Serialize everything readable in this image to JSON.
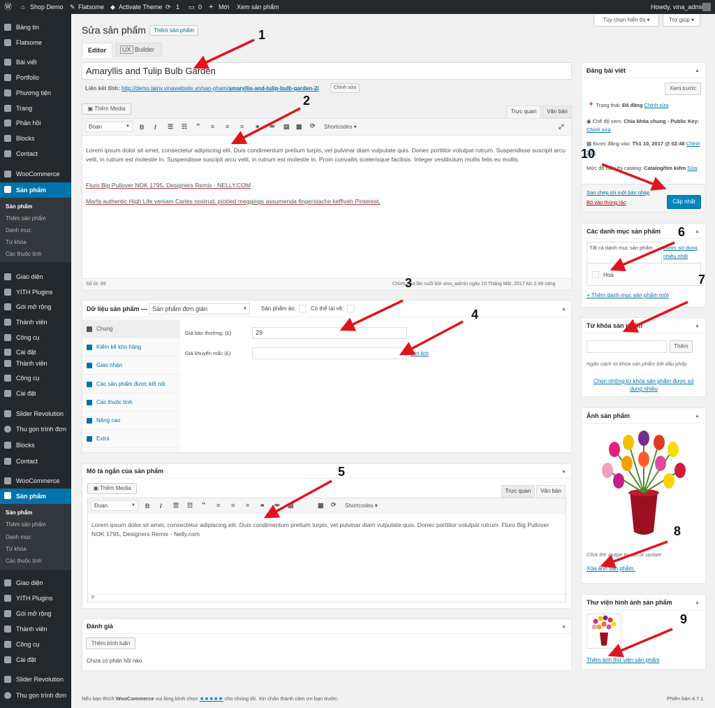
{
  "admin_bar": {
    "site": "Shop Demo",
    "theme": "Flatsome",
    "activate": "Activate Theme",
    "updates": "1",
    "comments": "0",
    "new": "Mới",
    "view": "Xem sản phẩm",
    "howdy": "Howdy, vina_admin"
  },
  "sidebar": {
    "top": [
      "Bảng tin",
      "Flatsome"
    ],
    "group1": [
      "Bài viết",
      "Portfolio",
      "Phương tiện",
      "Trang",
      "Phản hồi",
      "Blocks",
      "Contact"
    ],
    "woo": "WooCommerce",
    "products": "Sản phẩm",
    "sub": [
      "Sản phẩm",
      "Thêm sản phẩm",
      "Danh mục",
      "Từ khóa",
      "Các thuộc tính"
    ],
    "group2": [
      "Giao diện",
      "YITH Plugins",
      "Gói mở rộng",
      "Thành viên",
      "Công cụ",
      "Cài đặt"
    ],
    "mid_extra": [
      "Thành viên",
      "Công cụ",
      "Cài đặt"
    ],
    "slider": "Slider Revolution",
    "collapse": "Thu gọn trình đơn",
    "blocks": "Blocks",
    "contact": "Contact"
  },
  "screen_options": "Tùy chọn hiển thị ▾",
  "help": "Trợ giúp ▾",
  "page_title": "Sửa sản phẩm",
  "add_product": "Thêm sản phẩm",
  "editor_tabs": [
    "Editor",
    "UX",
    "Builder"
  ],
  "post_title": "Amaryllis and Tulip Bulb Garden",
  "permalink": {
    "label": "Liên kết tĩnh:",
    "url_pre": "http://demo.tainv.vinawebsite.vn/san-pham/",
    "slug": "amaryllis-and-tulip-bulb-garden-2/",
    "edit": "Chỉnh sửa"
  },
  "editor": {
    "add_media": "Thêm Media",
    "visual": "Trực quan",
    "text": "Văn bản",
    "format": "Đoạn",
    "shortcodes": "Shortcodes",
    "p1": "Lorem ipsum dolor sit amet, consectetur adipiscing elit. Duis condimentum pretium turpis, vel pulvinar diam vulputate quis. Donec porttitor volutpat rutrum. Suspendisse suscipit arcu velit, in rutrum est molestie in. Suspendisse suscipit arcu velit, in rutrum est molestie in. Proin convallis scelerisque facilisis. Integer vestibulum mollis felis eu mollis.",
    "p2": "Fluro Big Pullover NOK 1795, Designers Remix - NELLY.COM",
    "p3": "Marfa authentic High Life veniam Carles nostrud, pickled meggings assumenda fingerstache keffiyeh Pinterest.",
    "word_count": "Số từ: 69",
    "last_edit": "Chỉnh sửa lần cuối bởi vina_admin ngày 10 Tháng Một, 2017 lúc 2:49 sáng"
  },
  "product_data": {
    "title": "Dữ liệu sản phẩm —",
    "type": "Sản phẩm đơn giản",
    "virtual": "Sản phẩm ảo:",
    "downloadable": "Có thể tải về:",
    "tabs": [
      "Chung",
      "Kiểm kê kho hàng",
      "Giao nhận",
      "Các sản phẩm được kết nối",
      "Các thuộc tính",
      "Nâng cao",
      "Extra"
    ],
    "regular_label": "Giá bán thường: (£)",
    "regular_value": "29",
    "sale_label": "Giá khuyến mãi: (£)",
    "sale_value": "",
    "schedule": "Lên lịch"
  },
  "short_desc": {
    "title": "Mô tả ngắn của sản phẩm",
    "add_media": "Thêm Media",
    "visual": "Trực quan",
    "text": "Văn bản",
    "format": "Đoạn",
    "shortcodes": "Shortcodes",
    "body": "Lorem ipsum dolor sit amet, consectetur adipiscing elit. Duis condimentum pretium turpis, vel pulvinar diam vulputate quis. Donec porttitor volutpat rutrum. Fluro Big Pullover NOK 1795, Designers Remix - Nelly.com",
    "path": "P"
  },
  "reviews": {
    "title": "Đánh giá",
    "add": "Thêm bình luận",
    "none": "Chưa có phản hồi nào."
  },
  "publish": {
    "title": "Đăng bài viết",
    "preview": "Xem trước",
    "status_label": "Trạng thái:",
    "status": "Đã đăng",
    "edit": "Chỉnh sửa",
    "visibility_label": "Chế độ xem:",
    "visibility": "Chìa khóa chung - Public Key:",
    "published_label": "Được đăng vào:",
    "published": "Th1 10, 2017 @ 02:48",
    "catalog_label": "Mức độ hiển thị catalog:",
    "catalog": "Catalog/tìm kiếm",
    "catalog_edit": "Sửa",
    "copy": "Sao chép tới một bản nháp",
    "trash": "Bỏ vào thùng rác",
    "update": "Cập nhật"
  },
  "categories": {
    "title": "Các danh mục sản phẩm",
    "all": "Tất cả danh mục sản phẩm",
    "most_used": "Được sử dụng nhiều nhất",
    "item": "Hoa",
    "add": "+ Thêm danh mục sản phẩm mới"
  },
  "tags": {
    "title": "Từ khóa sản phẩm",
    "add": "Thêm",
    "hint": "Ngăn cách từ khóa sản phẩm bởi dấu phẩy",
    "choose": "Chọn những từ khóa sản phẩm được sử dụng nhiều"
  },
  "image": {
    "title": "Ảnh sản phẩm",
    "hint": "Click the image to edit or update",
    "remove": "Xóa ảnh sản phẩm."
  },
  "gallery": {
    "title": "Thư viện hình ảnh sản phẩm",
    "add": "Thêm ảnh thư viện sản phẩm"
  },
  "footer": {
    "pre": "Nếu bạn thích",
    "woo": "WooCommerce",
    "mid": "vui lòng bình chọn",
    "stars": "★★★★★",
    "post": "cho chúng tôi. Xin chân thành cảm ơn bạn trước.",
    "version": "Phiên bản 4.7.1"
  },
  "annotations": [
    "1",
    "2",
    "3",
    "4",
    "5",
    "6",
    "7",
    "8",
    "9",
    "10"
  ],
  "colors": {
    "accent": "#0073aa",
    "admin_bar": "#23282d",
    "arrow": "#e0141e",
    "update_button": "#0085ba"
  }
}
